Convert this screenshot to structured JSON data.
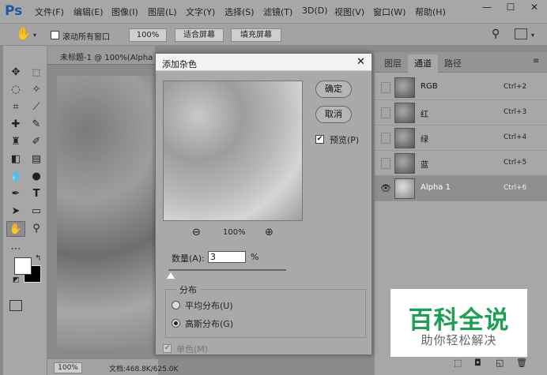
{
  "app": {
    "logo": "Ps"
  },
  "menu": [
    "文件(F)",
    "编辑(E)",
    "图像(I)",
    "图层(L)",
    "文字(Y)",
    "选择(S)",
    "滤镜(T)",
    "3D(D)",
    "视图(V)",
    "窗口(W)",
    "帮助(H)"
  ],
  "window_controls": {
    "minimize": "—",
    "maximize": "☐",
    "close": "✕"
  },
  "options_bar": {
    "scroll_all_label": "滚动所有窗口",
    "zoom_value": "100%",
    "fit_screen": "适合屏幕",
    "fill_screen": "填充屏幕"
  },
  "document": {
    "tab_title": "未标题-1 @ 100%(Alpha",
    "zoom": "100%",
    "doc_info": "文档:468.8K/625.0K"
  },
  "panel": {
    "tabs": [
      "图层",
      "通道",
      "路径"
    ],
    "active_tab": "通道",
    "channels": [
      {
        "name": "RGB",
        "shortcut": "Ctrl+2",
        "visible": false
      },
      {
        "name": "红",
        "shortcut": "Ctrl+3",
        "visible": false
      },
      {
        "name": "绿",
        "shortcut": "Ctrl+4",
        "visible": false
      },
      {
        "name": "蓝",
        "shortcut": "Ctrl+5",
        "visible": false
      },
      {
        "name": "Alpha 1",
        "shortcut": "Ctrl+6",
        "visible": true
      }
    ]
  },
  "dialog": {
    "title": "添加杂色",
    "ok": "确定",
    "cancel": "取消",
    "preview_label": "预览(P)",
    "preview_checked": true,
    "zoom_level": "100%",
    "amount_label": "数量(A):",
    "amount_value": "3",
    "amount_unit": "%",
    "distribution_label": "分布",
    "uniform": "平均分布(U)",
    "gaussian": "高斯分布(G)",
    "selected_distribution": "gaussian",
    "mono_label": "单色(M)",
    "mono_checked": true
  },
  "watermark": {
    "title": "百科全说",
    "subtitle": "助你轻松解决"
  },
  "colors": {
    "ui_gray": "#a7a7a7",
    "watermark_green": "#1ba053",
    "logo_blue": "#1b5aa8"
  }
}
